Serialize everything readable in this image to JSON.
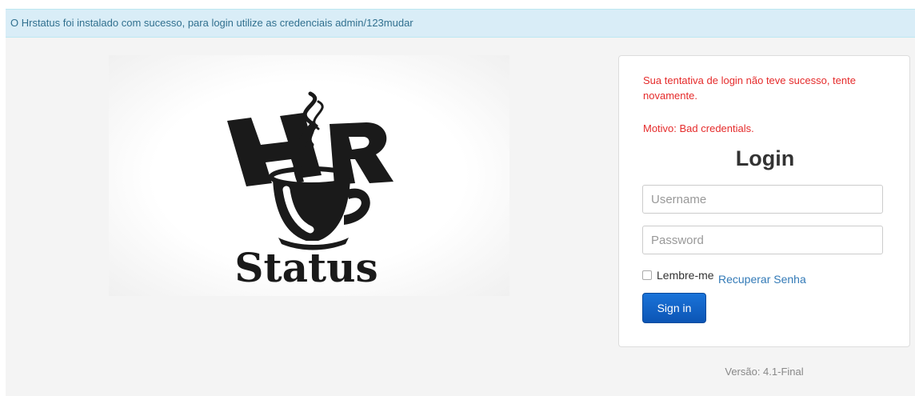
{
  "alert": {
    "message": "O Hrstatus foi instalado com sucesso, para login utilize as credenciais admin/123mudar"
  },
  "logo": {
    "icon": "hr-status-coffee-cup-logo",
    "text": "HR Status"
  },
  "login": {
    "error_message": "Sua tentativa de login não teve sucesso, tente novamente.",
    "error_reason": "Motivo: Bad credentials.",
    "title": "Login",
    "username_placeholder": "Username",
    "password_placeholder": "Password",
    "remember_label": "Lembre-me",
    "remember_checked": false,
    "recover_label": "Recuperar Senha",
    "signin_label": "Sign in"
  },
  "footer": {
    "version": "Versão: 4.1-Final"
  },
  "colors": {
    "alert_background": "#d9edf7",
    "alert_text": "#31708f",
    "error_text": "#e52b2b",
    "link": "#337ab7",
    "primary_button": "#0c55b5"
  }
}
